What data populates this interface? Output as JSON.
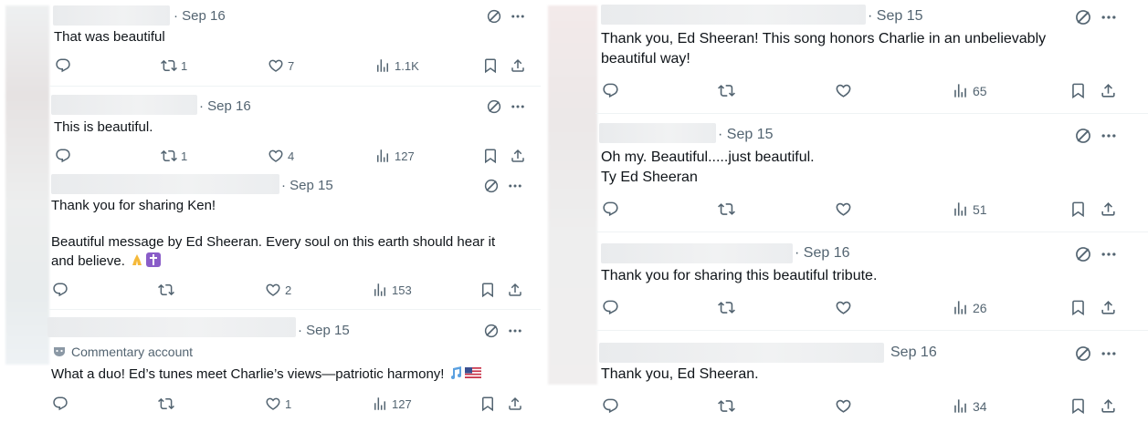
{
  "left": {
    "tweets": [
      {
        "date": "· Sep 16",
        "text": "That was beautiful",
        "reposts": "1",
        "likes": "7",
        "views": "1.1K"
      },
      {
        "date": "· Sep 16",
        "text": "This is beautiful.",
        "reposts": "1",
        "likes": "4",
        "views": "127"
      },
      {
        "date": "· Sep 15",
        "text": "Thank you for sharing Ken!\n\nBeautiful message by Ed Sheeran.  Every soul on this earth should hear it\nand believe.",
        "reposts": "",
        "likes": "2",
        "views": "153"
      },
      {
        "date": "· Sep 15",
        "label": "Commentary account",
        "text": "What a duo! Ed’s tunes meet Charlie’s views—patriotic harmony!",
        "reposts": "",
        "likes": "1",
        "views": "127"
      }
    ]
  },
  "right": {
    "tweets": [
      {
        "date": "· Sep 15",
        "text": "Thank you, Ed Sheeran! This song honors Charlie in an unbelievably\nbeautiful way!",
        "views": "65"
      },
      {
        "date": "· Sep 15",
        "text": "Oh my.  Beautiful.....just beautiful.\nTy Ed Sheeran",
        "views": "51"
      },
      {
        "date": "· Sep 16",
        "text": "Thank you for sharing this beautiful tribute.",
        "views": "26"
      },
      {
        "date": "Sep 16",
        "text": "Thank you, Ed Sheeran.",
        "views": "34"
      }
    ]
  },
  "icons": {
    "reply": "reply-icon",
    "repost": "repost-icon",
    "like": "like-icon",
    "views": "views-icon",
    "bookmark": "bookmark-icon",
    "share": "share-icon",
    "grok": "grok-icon",
    "more": "more-icon"
  },
  "colors": {
    "text": "#0f1419",
    "muted": "#536471",
    "divider": "#eff3f4"
  }
}
